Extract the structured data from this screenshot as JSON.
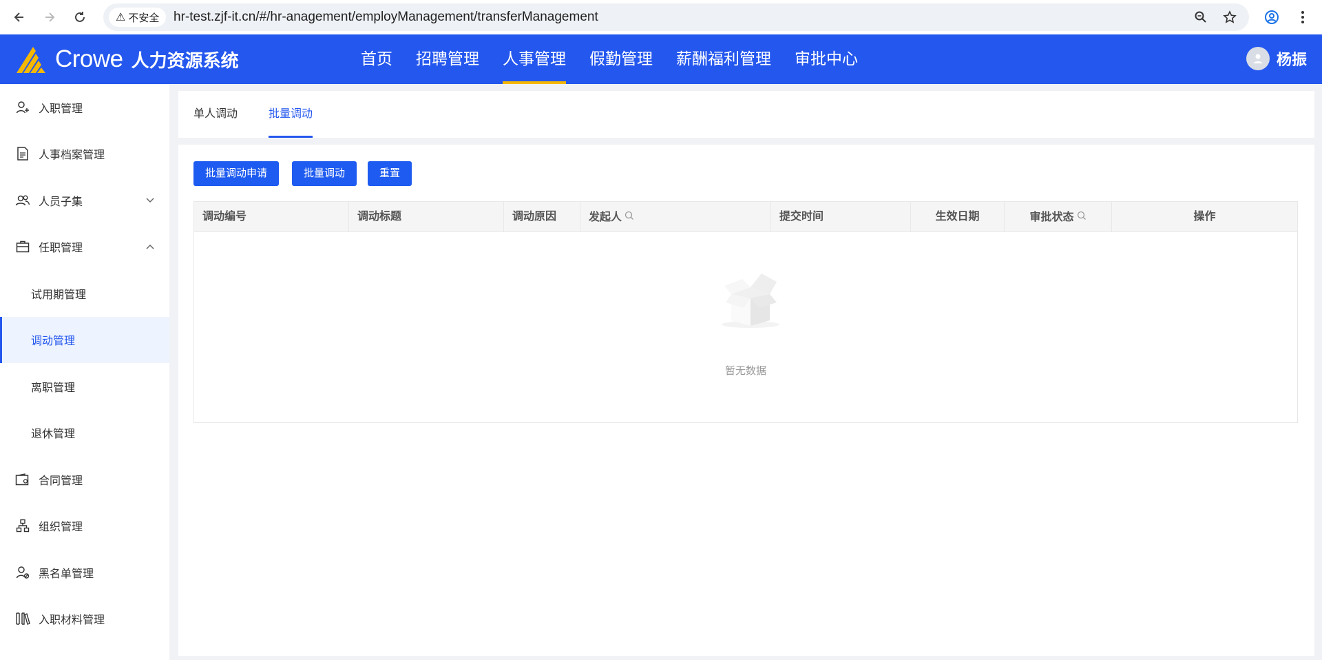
{
  "browser": {
    "security_label": "不安全",
    "url": "hr-test.zjf-it.cn/#/hr-anagement/employManagement/transferManagement"
  },
  "header": {
    "brand": "Crowe",
    "system_name": "人力资源系统",
    "nav": [
      "首页",
      "招聘管理",
      "人事管理",
      "假勤管理",
      "薪酬福利管理",
      "审批中心"
    ],
    "active_nav": "人事管理",
    "user_name": "杨振",
    "colors": {
      "header_bg": "#2457ee",
      "active_underline": "#f5b700"
    }
  },
  "sidebar": {
    "items": [
      {
        "label": "入职管理",
        "icon": "user-add-icon"
      },
      {
        "label": "人事档案管理",
        "icon": "document-icon"
      },
      {
        "label": "人员子集",
        "icon": "users-icon",
        "arrow": "chevron-down-icon"
      },
      {
        "label": "任职管理",
        "icon": "briefcase-icon",
        "arrow": "chevron-up-icon"
      },
      {
        "label": "试用期管理"
      },
      {
        "label": "调动管理",
        "active": true
      },
      {
        "label": "离职管理"
      },
      {
        "label": "退休管理"
      },
      {
        "label": "合同管理",
        "icon": "wallet-icon"
      },
      {
        "label": "组织管理",
        "icon": "org-chart-icon"
      },
      {
        "label": "黑名单管理",
        "icon": "user-block-icon"
      },
      {
        "label": "入职材料管理",
        "icon": "books-icon"
      }
    ]
  },
  "tabs": {
    "items": [
      "单人调动",
      "批量调动"
    ],
    "active": "批量调动"
  },
  "toolbar": {
    "apply_label": "批量调动申请",
    "transfer_label": "批量调动",
    "reset_label": "重置"
  },
  "table": {
    "columns": [
      "调动编号",
      "调动标题",
      "调动原因",
      "发起人",
      "提交时间",
      "生效日期",
      "审批状态",
      "操作"
    ],
    "rows": [],
    "empty_text": "暂无数据"
  }
}
